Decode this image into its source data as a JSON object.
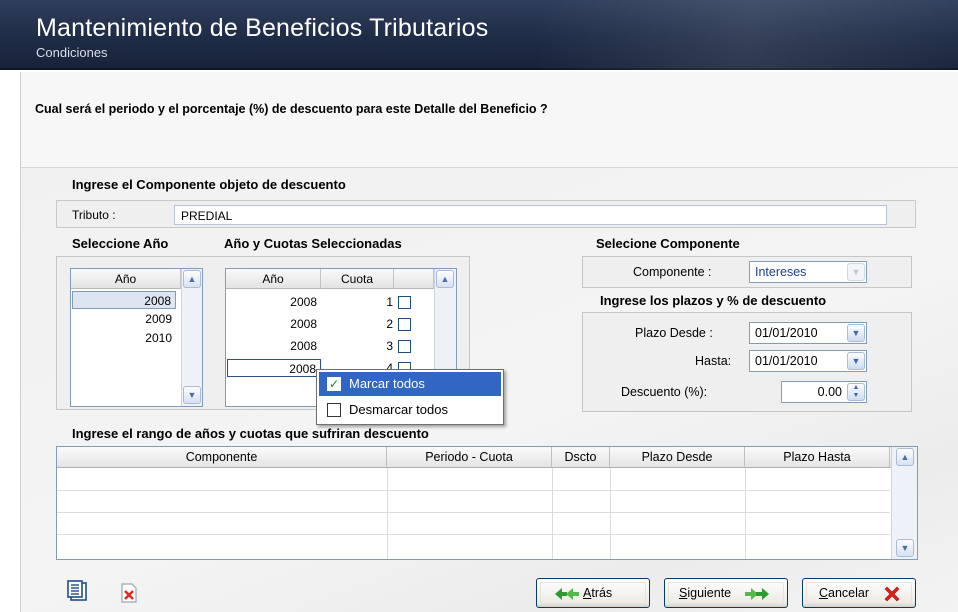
{
  "header": {
    "title": "Mantenimiento de Beneficios Tributarios",
    "subtitle": "Condiciones"
  },
  "question": "Cual será el periodo y el porcentaje (%) de descuento para este Detalle del Beneficio ?",
  "componente_section": {
    "title": "Ingrese el Componente objeto de descuento",
    "tributo_label": "Tributo :",
    "tributo_value": "PREDIAL"
  },
  "anio_section": {
    "title": "Seleccione Año",
    "column": "Año",
    "items": [
      "2008",
      "2009",
      "2010"
    ]
  },
  "cuotas_section": {
    "title": "Año y Cuotas Seleccionadas",
    "columns": [
      "Año",
      "Cuota"
    ],
    "rows": [
      {
        "anio": "2008",
        "cuota": "1"
      },
      {
        "anio": "2008",
        "cuota": "2"
      },
      {
        "anio": "2008",
        "cuota": "3"
      },
      {
        "anio": "2008",
        "cuota": "4"
      }
    ]
  },
  "context_menu": {
    "items": [
      "Marcar todos",
      "Desmarcar todos"
    ]
  },
  "selecione_componente": {
    "title": "Selecione Componente",
    "label": "Componente :",
    "value": "Intereses"
  },
  "plazos": {
    "title": "Ingrese los plazos y % de descuento",
    "desde_label": "Plazo Desde :",
    "desde_value": "01/01/2010",
    "hasta_label": "Hasta:",
    "hasta_value": "01/01/2010",
    "descuento_label": "Descuento (%):",
    "descuento_value": "0.00"
  },
  "rango_section": {
    "title": "Ingrese el rango de años y cuotas que sufriran descuento",
    "columns": [
      "Componente",
      "Periodo - Cuota",
      "Dscto",
      "Plazo Desde",
      "Plazo Hasta"
    ]
  },
  "buttons": {
    "atras_u": "A",
    "atras_rest": "trás",
    "siguiente_u": "S",
    "siguiente_rest": "iguiente",
    "cancelar_u": "C",
    "cancelar_rest": "ancelar"
  },
  "colors": {
    "header_bg": "#1f2c47",
    "selection": "#3166c4",
    "accent_green": "#2a8a2a",
    "cancel_red": "#e0201a"
  },
  "icons": [
    "detail-view-icon",
    "delete-icon",
    "arrow-left-icon",
    "arrow-right-icon",
    "cancel-x-icon",
    "chevron-up-icon",
    "chevron-down-icon",
    "spin-icon"
  ]
}
